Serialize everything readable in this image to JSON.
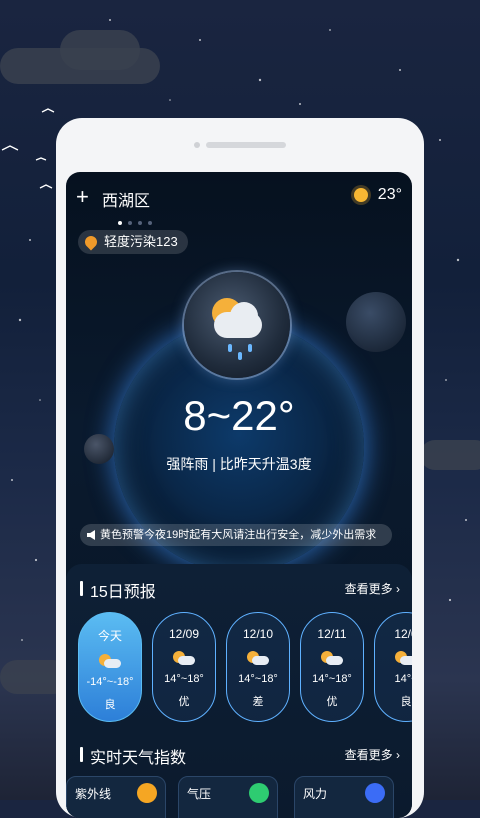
{
  "header": {
    "city": "西湖区",
    "current_temp": "23°",
    "plus_icon": "+"
  },
  "aqi": {
    "label": "轻度污染123"
  },
  "weather": {
    "range": "8~22°",
    "description": "强阵雨  |  比昨天升温3度"
  },
  "warning": {
    "text": "黄色预警今夜19时起有大风请注出行安全，减少外出需求"
  },
  "forecast": {
    "title": "15日预报",
    "more": "查看更多",
    "days": [
      {
        "date": "今天",
        "temp": "-14°~-18°",
        "quality": "良"
      },
      {
        "date": "12/09",
        "temp": "14°~18°",
        "quality": "优"
      },
      {
        "date": "12/10",
        "temp": "14°~18°",
        "quality": "差"
      },
      {
        "date": "12/11",
        "temp": "14°~18°",
        "quality": "优"
      },
      {
        "date": "12/0",
        "temp": "14°~",
        "quality": "良"
      }
    ]
  },
  "indices": {
    "title": "实时天气指数",
    "more": "查看更多",
    "items": [
      {
        "label": "紫外线",
        "color": "#f5a623"
      },
      {
        "label": "气压",
        "color": "#2ecc71"
      },
      {
        "label": "风力",
        "color": "#3b6cf6"
      }
    ]
  }
}
